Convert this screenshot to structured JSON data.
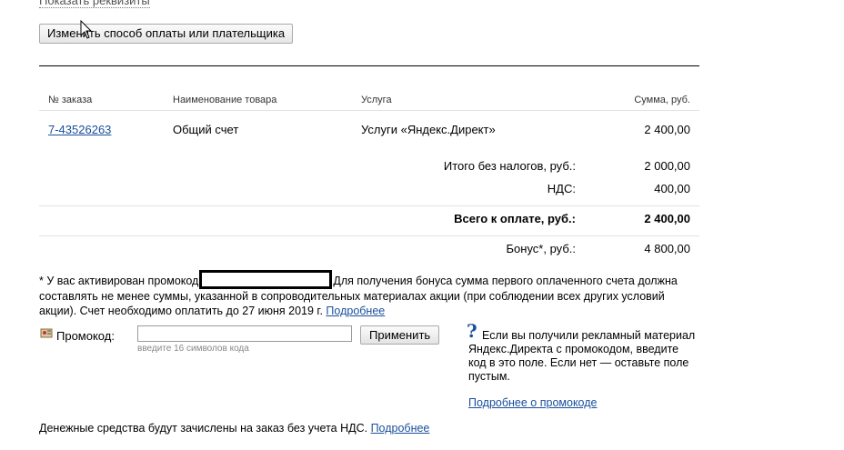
{
  "header": {
    "show_details_link": "Показать реквизиты",
    "change_button": "Изменить способ оплаты или плательщика"
  },
  "table": {
    "headers": {
      "order": "№ заказа",
      "product": "Наименование товара",
      "service": "Услуга",
      "sum": "Сумма, руб."
    },
    "row": {
      "order": "7-43526263",
      "product": "Общий счет",
      "service": "Услуги «Яндекс.Директ»",
      "sum": "2 400,00"
    }
  },
  "totals": {
    "no_tax_label": "Итого без налогов, руб.:",
    "no_tax_value": "2 000,00",
    "vat_label": "НДС:",
    "vat_value": "400,00",
    "total_label": "Всего к оплате, руб.:",
    "total_value": "2 400,00",
    "bonus_label": "Бонус*, руб.:",
    "bonus_value": "4 800,00"
  },
  "note": {
    "part1": "* У вас активирован промокод",
    "part2": "Для получения бонуса сумма первого оплаченного счета должна составлять не менее суммы, указанной в сопроводительных материалах акции (при соблюдении всех других условий акции). Счет необходимо оплатить до 27 июня 2019 г.",
    "more_link": "Подробнее"
  },
  "promo": {
    "label": "Промокод:",
    "input_value": "",
    "hint": "введите 16 символов кода",
    "apply_button": "Применить",
    "help_text": "Если вы получили рекламный материал Яндекс.Директа с промокодом, введите код в это поле. Если нет — оставьте поле пустым.",
    "help_link": "Подробнее о промокоде"
  },
  "footer": {
    "text": "Денежные средства будут зачислены на заказ без учета НДС.",
    "more_link": "Подробнее"
  },
  "icons": {
    "help": "question-icon",
    "promo": "promo-icon",
    "cursor": "cursor-icon"
  }
}
